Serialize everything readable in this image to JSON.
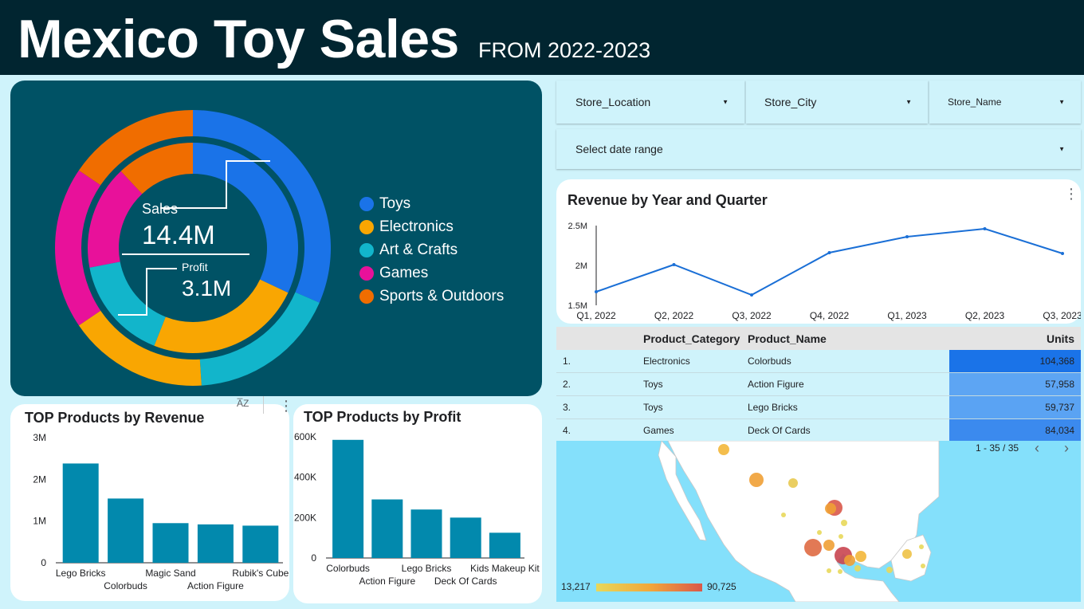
{
  "header": {
    "title": "Mexico Toy Sales",
    "subtitle": "FROM 2022-2023"
  },
  "kpi": {
    "sales_label": "Sales",
    "sales_value": "14.4M",
    "profit_label": "Profit",
    "profit_value": "3.1M"
  },
  "colors": {
    "header_bg": "#012530",
    "page_bg": "#cff3fb",
    "panel_bg": "#005265",
    "bar": "#0289ad",
    "line": "#1a6fd6",
    "toys": "#1a73e8",
    "electronics": "#f9a602",
    "art_crafts": "#12b5cb",
    "games": "#e8119a",
    "sports": "#f06d00"
  },
  "legend": [
    {
      "label": "Toys",
      "color": "#1a73e8"
    },
    {
      "label": "Electronics",
      "color": "#f9a602"
    },
    {
      "label": "Art & Crafts",
      "color": "#12b5cb"
    },
    {
      "label": "Games",
      "color": "#e8119a"
    },
    {
      "label": "Sports & Outdoors",
      "color": "#f06d00"
    }
  ],
  "filters": {
    "store_location": "Store_Location",
    "store_city": "Store_City",
    "store_name": "Store_Name",
    "date_range": "Select date range"
  },
  "table": {
    "headers": {
      "category": "Product_Category",
      "name": "Product_Name",
      "units": "Units"
    },
    "rows": [
      {
        "index": "1.",
        "category": "Electronics",
        "name": "Colorbuds",
        "units": "104,368",
        "color": "#1a73e8"
      },
      {
        "index": "2.",
        "category": "Toys",
        "name": "Action Figure",
        "units": "57,958",
        "color": "#5da5f3"
      },
      {
        "index": "3.",
        "category": "Toys",
        "name": "Lego Bricks",
        "units": "59,737",
        "color": "#5aa3f3"
      },
      {
        "index": "4.",
        "category": "Games",
        "name": "Deck Of Cards",
        "units": "84,034",
        "color": "#3b8aee"
      }
    ]
  },
  "pager": {
    "text": "1 - 35 / 35",
    "prev_icon": "chevron-left-icon",
    "next_icon": "chevron-right-icon"
  },
  "map": {
    "scale_min": "13,217",
    "scale_max": "90,725",
    "color_min": "#e8d85a",
    "color_max": "#d9584a"
  },
  "chart_data": [
    {
      "type": "pie",
      "title": "",
      "rings": [
        {
          "name": "outer",
          "slices": [
            {
              "label": "Toys",
              "value": 31.5
            },
            {
              "label": "Art & Crafts",
              "value": 17.5
            },
            {
              "label": "Electronics",
              "value": 16.5
            },
            {
              "label": "Games",
              "value": 19
            },
            {
              "label": "Sports & Outdoors",
              "value": 15.5
            }
          ]
        },
        {
          "name": "inner",
          "slices": [
            {
              "label": "Toys",
              "value": 32
            },
            {
              "label": "Electronics",
              "value": 24
            },
            {
              "label": "Art & Crafts",
              "value": 16
            },
            {
              "label": "Games",
              "value": 16
            },
            {
              "label": "Sports & Outdoors",
              "value": 12
            }
          ]
        }
      ]
    },
    {
      "type": "line",
      "title": "Revenue by Year and Quarter",
      "xlabel": "",
      "ylabel": "",
      "categories": [
        "Q1, 2022",
        "Q2, 2022",
        "Q3, 2022",
        "Q4, 2022",
        "Q1, 2023",
        "Q2, 2023",
        "Q3, 2023"
      ],
      "values": [
        1.67,
        2.01,
        1.63,
        2.16,
        2.36,
        2.46,
        2.15
      ],
      "yticks": [
        "2.5M",
        "2M",
        "1.5M"
      ],
      "ylim": [
        1.5,
        2.5
      ]
    },
    {
      "type": "bar",
      "title": "TOP Products by Revenue",
      "categories": [
        "Lego Bricks",
        "Colorbuds",
        "Magic Sand",
        "Action Figure",
        "Rubik's Cube"
      ],
      "values": [
        2.38,
        1.54,
        0.95,
        0.92,
        0.89
      ],
      "yticks": [
        "3M",
        "2M",
        "1M",
        "0"
      ],
      "ylim": [
        0,
        3
      ]
    },
    {
      "type": "bar",
      "title": "TOP Products by Profit",
      "categories": [
        "Colorbuds",
        "Action Figure",
        "Lego Bricks",
        "Deck Of Cards",
        "Kids Makeup Kit"
      ],
      "values": [
        585,
        290,
        240,
        200,
        125
      ],
      "yticks": [
        "600K",
        "400K",
        "200K",
        "0"
      ],
      "ylim": [
        0,
        600
      ]
    }
  ]
}
